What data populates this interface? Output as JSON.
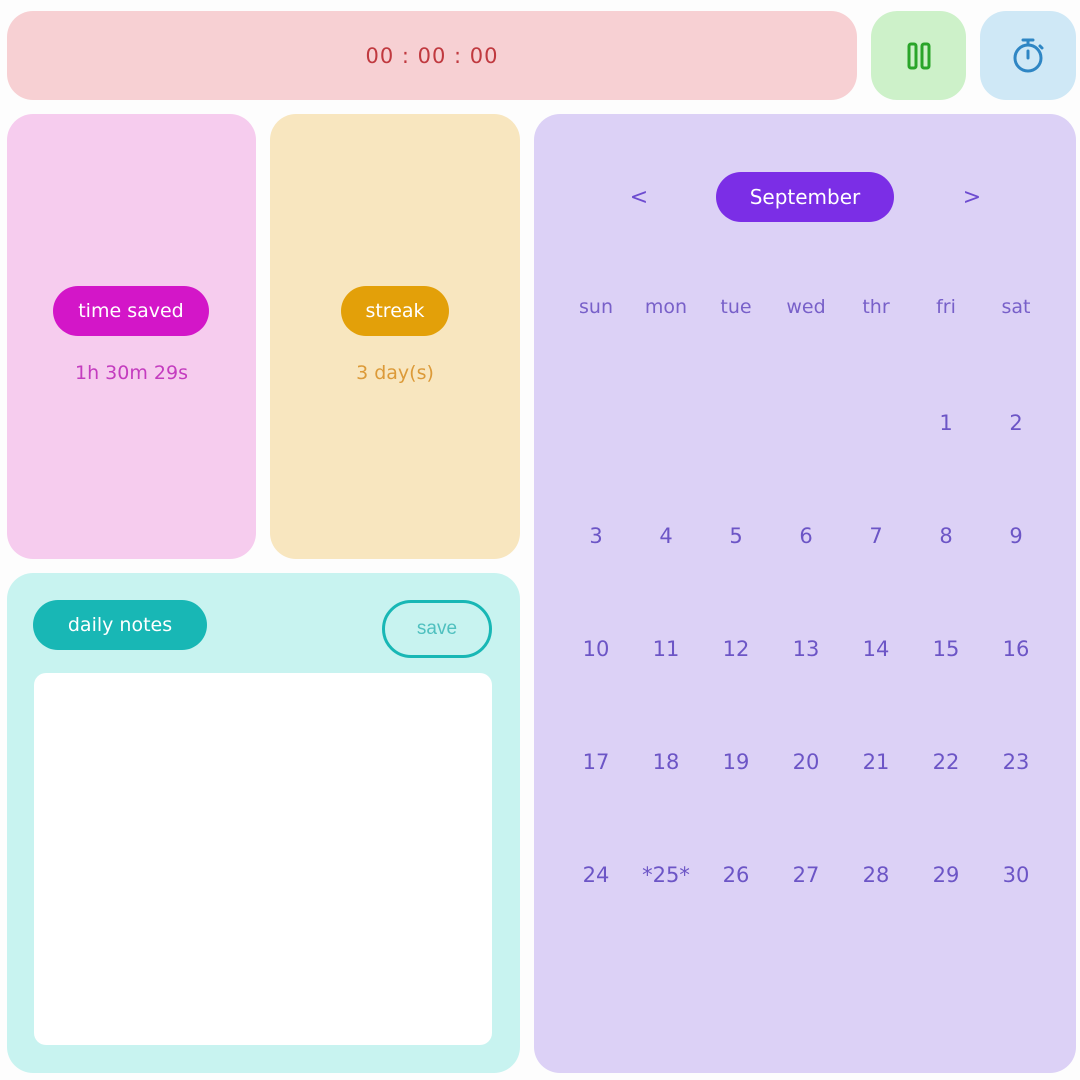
{
  "timer": {
    "display": "00 : 00 : 00"
  },
  "controls": {
    "pause_icon": "pause-icon",
    "stopwatch_icon": "stopwatch-icon"
  },
  "stats": {
    "time_saved_label": "time saved",
    "time_saved_value": "1h 30m 29s",
    "streak_label": "streak",
    "streak_value": "3 day(s)"
  },
  "notes": {
    "title": "daily notes",
    "save_label": "save",
    "content": ""
  },
  "calendar": {
    "month": "September",
    "prev_label": "<",
    "next_label": ">",
    "weekdays": [
      "sun",
      "mon",
      "tue",
      "wed",
      "thr",
      "fri",
      "sat"
    ],
    "weeks": [
      [
        "",
        "",
        "",
        "",
        "",
        "1",
        "2"
      ],
      [
        "3",
        "4",
        "5",
        "6",
        "7",
        "8",
        "9"
      ],
      [
        "10",
        "11",
        "12",
        "13",
        "14",
        "15",
        "16"
      ],
      [
        "17",
        "18",
        "19",
        "20",
        "21",
        "22",
        "23"
      ],
      [
        "24",
        "*25*",
        "26",
        "27",
        "28",
        "29",
        "30"
      ]
    ]
  },
  "colors": {
    "timer_bg": "#f7d0d3",
    "pause_bg": "#cdf1c9",
    "stopwatch_bg": "#cfe8f6",
    "time_saved_accent": "#d316c8",
    "streak_accent": "#e3a009",
    "notes_accent": "#18b7b5",
    "calendar_accent": "#7b2ee6"
  }
}
